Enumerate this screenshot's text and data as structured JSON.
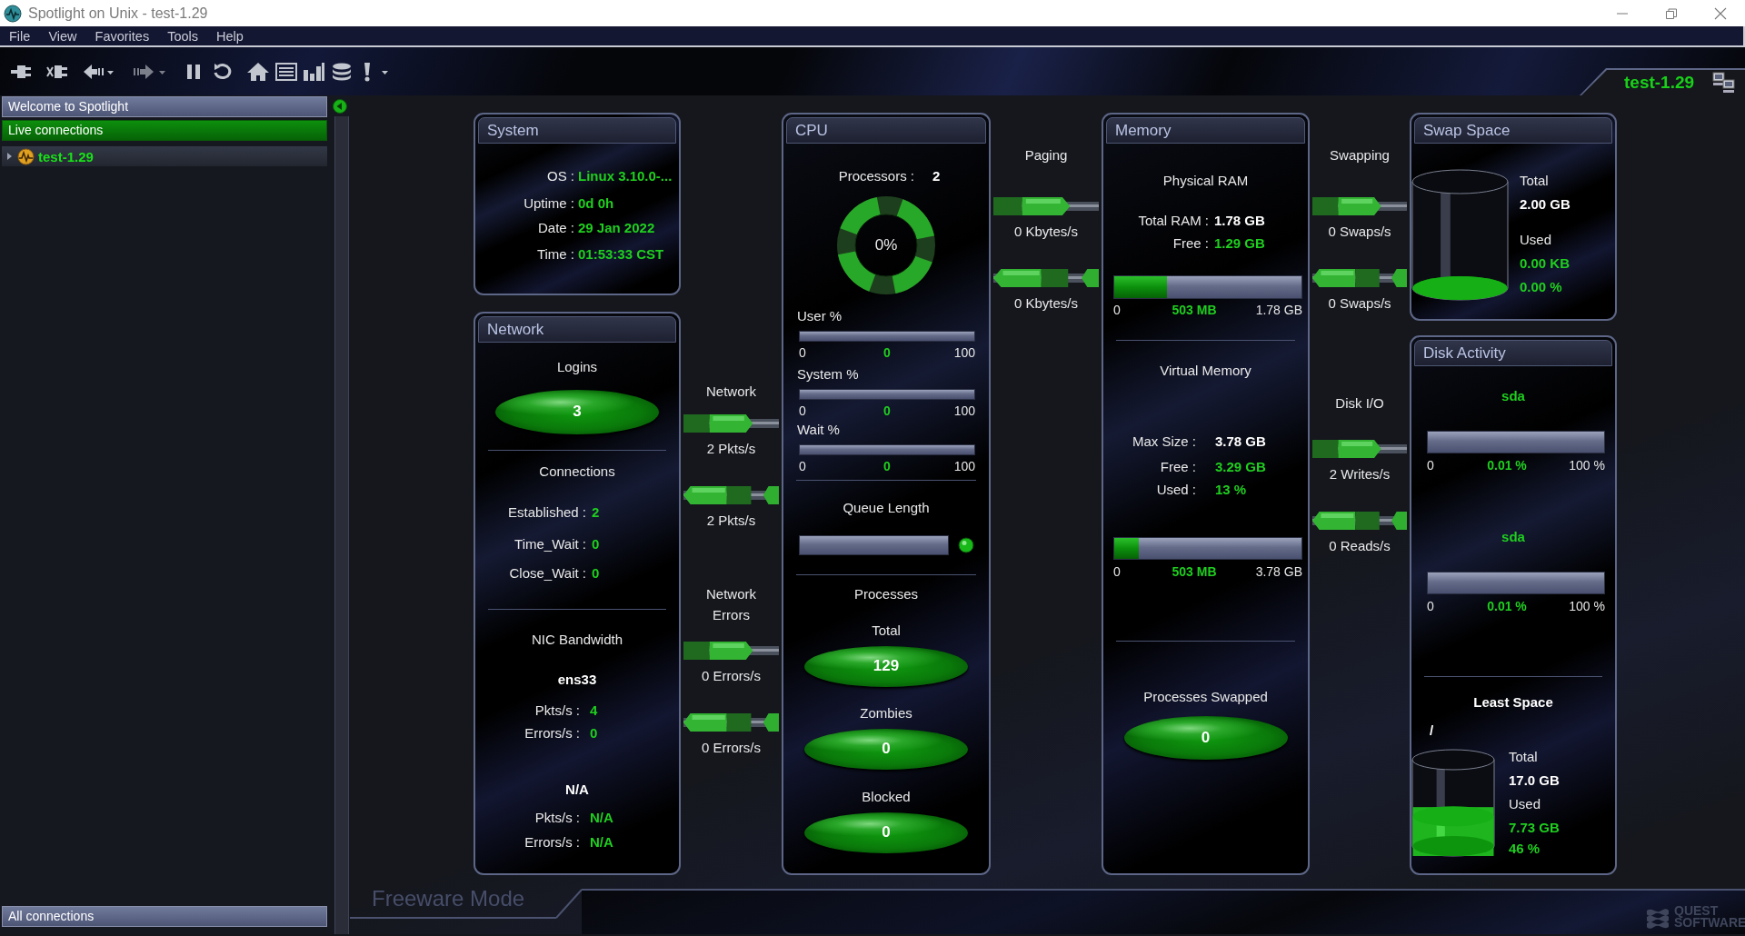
{
  "window": {
    "title": "Spotlight on Unix - test-1.29"
  },
  "menu": [
    {
      "label": "File"
    },
    {
      "label": "View"
    },
    {
      "label": "Favorites"
    },
    {
      "label": "Tools"
    },
    {
      "label": "Help"
    }
  ],
  "connection_tab": {
    "label": "test-1.29"
  },
  "sidebar": {
    "bars": [
      {
        "label": "Welcome to Spotlight",
        "selected": false
      },
      {
        "label": "Live connections",
        "selected": true
      }
    ],
    "items": [
      {
        "label": "test-1.29",
        "expanded": false
      }
    ],
    "bottom_bars": [
      {
        "label": "All connections",
        "selected": false
      }
    ]
  },
  "system": {
    "title": "System",
    "fields": [
      {
        "label": "OS :",
        "value": "Linux 3.10.0-..."
      },
      {
        "label": "Uptime :",
        "value": "0d 0h"
      },
      {
        "label": "Date :",
        "value": "29 Jan 2022"
      },
      {
        "label": "Time :",
        "value": "01:53:33 CST"
      }
    ]
  },
  "network": {
    "title": "Network",
    "logins": {
      "label": "Logins",
      "value": "3"
    },
    "connections": {
      "title": "Connections",
      "fields": [
        {
          "label": "Established :",
          "value": "2"
        },
        {
          "label": "Time_Wait :",
          "value": "0"
        },
        {
          "label": "Close_Wait :",
          "value": "0"
        }
      ]
    },
    "nic_bandwidth": {
      "title": "NIC Bandwidth",
      "interfaces": [
        {
          "name": "ens33",
          "fields": [
            {
              "label": "Pkts/s :",
              "value": "4"
            },
            {
              "label": "Errors/s :",
              "value": "0"
            }
          ]
        },
        {
          "name": "N/A",
          "fields": [
            {
              "label": "Pkts/s :",
              "value": "N/A"
            },
            {
              "label": "Errors/s :",
              "value": "N/A"
            }
          ]
        }
      ]
    }
  },
  "flows": [
    {
      "title": "Network",
      "gauges": [
        {
          "reading": "2 Pkts/s",
          "kind": "right"
        },
        {
          "reading": "2 Pkts/s",
          "kind": "left"
        }
      ]
    },
    {
      "title": "Network Errors",
      "gauges": [
        {
          "reading": "0 Errors/s",
          "kind": "right"
        },
        {
          "reading": "0 Errors/s",
          "kind": "left"
        }
      ]
    },
    {
      "title": "Paging",
      "gauges": [
        {
          "reading": "0 Kbytes/s",
          "kind": "right"
        },
        {
          "reading": "0 Kbytes/s",
          "kind": "left"
        }
      ]
    },
    {
      "title": "Swapping",
      "gauges": [
        {
          "reading": "0 Swaps/s",
          "kind": "right"
        },
        {
          "reading": "0 Swaps/s",
          "kind": "left"
        }
      ]
    },
    {
      "title": "Disk I/O",
      "gauges": [
        {
          "reading": "2 Writes/s",
          "kind": "right"
        },
        {
          "reading": "0 Reads/s",
          "kind": "left"
        }
      ]
    }
  ],
  "cpu": {
    "title": "CPU",
    "processors": {
      "label": "Processors :",
      "value": "2"
    },
    "usage": "0%",
    "bars": [
      {
        "label": "User %",
        "min": "0",
        "value": "0",
        "max": "100",
        "level": 0
      },
      {
        "label": "System %",
        "min": "0",
        "value": "0",
        "max": "100",
        "level": 0
      },
      {
        "label": "Wait %",
        "min": "0",
        "value": "0",
        "max": "100",
        "level": 0
      }
    ],
    "queue_length": {
      "label": "Queue Length",
      "level": 0
    },
    "processes": {
      "title": "Processes",
      "counters": [
        {
          "label": "Total",
          "value": "129"
        },
        {
          "label": "Zombies",
          "value": "0"
        },
        {
          "label": "Blocked",
          "value": "0"
        }
      ]
    }
  },
  "memory": {
    "title": "Memory",
    "physical_ram": {
      "title": "Physical RAM",
      "total": {
        "label": "Total RAM :",
        "value": "1.78 GB"
      },
      "free": {
        "label": "Free :",
        "value": "1.29 GB"
      },
      "bar": {
        "min": "0",
        "value": "503 MB",
        "max": "1.78 GB",
        "level": 0.28
      }
    },
    "virtual_memory": {
      "title": "Virtual Memory",
      "max_size": {
        "label": "Max Size :",
        "value": "3.78 GB"
      },
      "free": {
        "label": "Free :",
        "value": "3.29 GB"
      },
      "used": {
        "label": "Used :",
        "value": "13 %"
      },
      "bar": {
        "min": "0",
        "value": "503 MB",
        "max": "3.78 GB",
        "level": 0.13
      }
    },
    "processes_swapped": {
      "label": "Processes Swapped",
      "value": "0"
    }
  },
  "swap_space": {
    "title": "Swap Space",
    "level": 0,
    "total": {
      "label": "Total",
      "value": "2.00 GB"
    },
    "used": {
      "label": "Used",
      "values": [
        "0.00 KB",
        "0.00 %"
      ]
    }
  },
  "disk_activity": {
    "title": "Disk Activity",
    "devices": [
      {
        "name": "sda",
        "min": "0",
        "value": "0.01 %",
        "max": "100 %",
        "level": 0.0001
      },
      {
        "name": "sda",
        "min": "0",
        "value": "0.01 %",
        "max": "100 %",
        "level": 0.0001
      }
    ],
    "least_space": {
      "title": "Least Space",
      "mount": "/",
      "level": 0.46,
      "total": {
        "label": "Total",
        "value": "17.0 GB"
      },
      "used": {
        "label": "Used",
        "values": [
          "7.73 GB",
          "46 %"
        ]
      }
    }
  },
  "footer": {
    "mode": "Freeware Mode",
    "logo": "QUEST SOFTWARE"
  }
}
